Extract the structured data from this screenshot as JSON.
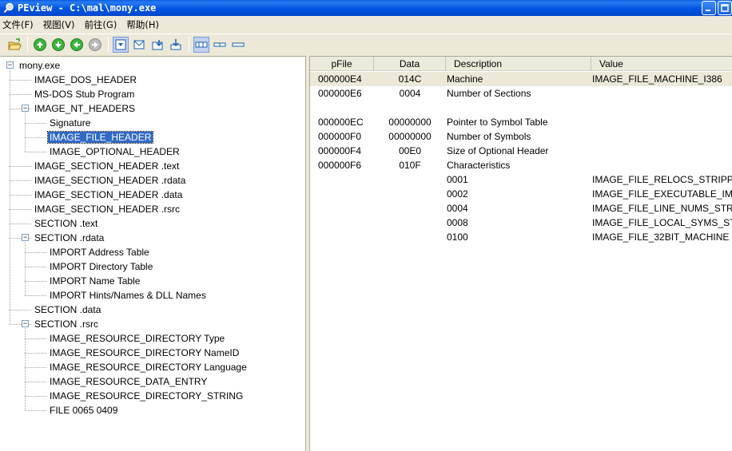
{
  "window": {
    "title": "PEview - C:\\mal\\mony.exe"
  },
  "menu": [
    "文件(F)",
    "视图(V)",
    "前往(G)",
    "帮助(H)"
  ],
  "toolbar": {
    "icons": [
      "open-file-icon",
      "back-icon",
      "forward-icon",
      "up-icon",
      "next-icon",
      "view-1-icon",
      "view-2-icon",
      "view-3-icon",
      "view-4-icon",
      "layout-1-icon",
      "layout-2-icon",
      "layout-3-icon"
    ]
  },
  "tree": [
    {
      "label": "mony.exe",
      "level": 0,
      "expander": "-"
    },
    {
      "label": "IMAGE_DOS_HEADER",
      "level": 1
    },
    {
      "label": "MS-DOS Stub Program",
      "level": 1
    },
    {
      "label": "IMAGE_NT_HEADERS",
      "level": 1,
      "expander": "-"
    },
    {
      "label": "Signature",
      "level": 2
    },
    {
      "label": "IMAGE_FILE_HEADER",
      "level": 2,
      "selected": true
    },
    {
      "label": "IMAGE_OPTIONAL_HEADER",
      "level": 2
    },
    {
      "label": "IMAGE_SECTION_HEADER .text",
      "level": 1
    },
    {
      "label": "IMAGE_SECTION_HEADER .rdata",
      "level": 1
    },
    {
      "label": "IMAGE_SECTION_HEADER .data",
      "level": 1
    },
    {
      "label": "IMAGE_SECTION_HEADER .rsrc",
      "level": 1
    },
    {
      "label": "SECTION .text",
      "level": 1
    },
    {
      "label": "SECTION .rdata",
      "level": 1,
      "expander": "-"
    },
    {
      "label": "IMPORT Address Table",
      "level": 2
    },
    {
      "label": "IMPORT Directory Table",
      "level": 2
    },
    {
      "label": "IMPORT Name Table",
      "level": 2
    },
    {
      "label": "IMPORT Hints/Names & DLL Names",
      "level": 2
    },
    {
      "label": "SECTION .data",
      "level": 1
    },
    {
      "label": "SECTION .rsrc",
      "level": 1,
      "expander": "-"
    },
    {
      "label": "IMAGE_RESOURCE_DIRECTORY Type",
      "level": 2
    },
    {
      "label": "IMAGE_RESOURCE_DIRECTORY NameID",
      "level": 2
    },
    {
      "label": "IMAGE_RESOURCE_DIRECTORY Language",
      "level": 2
    },
    {
      "label": "IMAGE_RESOURCE_DATA_ENTRY",
      "level": 2
    },
    {
      "label": "IMAGE_RESOURCE_DIRECTORY_STRING",
      "level": 2
    },
    {
      "label": "FILE  0065  0409",
      "level": 2
    }
  ],
  "list": {
    "columns": [
      "pFile",
      "Data",
      "Description",
      "Value"
    ],
    "rows": [
      {
        "pFile": "000000E4",
        "data": "014C",
        "description": "Machine",
        "value": "IMAGE_FILE_MACHINE_I386",
        "highlight": true
      },
      {
        "pFile": "000000E6",
        "data": "0004",
        "description": "Number of Sections",
        "value": ""
      },
      {
        "pFile": "",
        "data": "",
        "description": "",
        "value": ""
      },
      {
        "pFile": "000000EC",
        "data": "00000000",
        "description": "Pointer to Symbol Table",
        "value": ""
      },
      {
        "pFile": "000000F0",
        "data": "00000000",
        "description": "Number of Symbols",
        "value": ""
      },
      {
        "pFile": "000000F4",
        "data": "00E0",
        "description": "Size of Optional Header",
        "value": ""
      },
      {
        "pFile": "000000F6",
        "data": "010F",
        "description": "Characteristics",
        "value": ""
      },
      {
        "pFile": "",
        "data": "",
        "description": "0001",
        "value": "IMAGE_FILE_RELOCS_STRIPPED"
      },
      {
        "pFile": "",
        "data": "",
        "description": "0002",
        "value": "IMAGE_FILE_EXECUTABLE_IMAGE"
      },
      {
        "pFile": "",
        "data": "",
        "description": "0004",
        "value": "IMAGE_FILE_LINE_NUMS_STRIPPED"
      },
      {
        "pFile": "",
        "data": "",
        "description": "0008",
        "value": "IMAGE_FILE_LOCAL_SYMS_STRIPPED"
      },
      {
        "pFile": "",
        "data": "",
        "description": "0100",
        "value": "IMAGE_FILE_32BIT_MACHINE"
      }
    ]
  },
  "colors": {
    "titlebar": "#0054e3",
    "selection": "#316ac5",
    "face": "#ece9d8"
  }
}
